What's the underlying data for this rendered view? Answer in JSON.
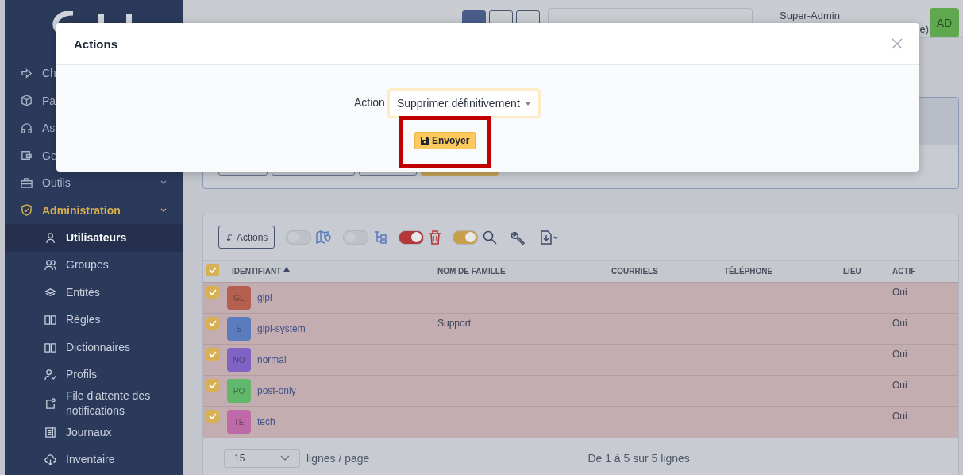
{
  "header": {
    "user": {
      "name": "Super-Admin",
      "entity": "e)",
      "initials": "AD"
    }
  },
  "sidebar": {
    "items": [
      {
        "label": "Ch",
        "selected": false
      },
      {
        "label": "Pa",
        "selected": false
      },
      {
        "label": "As",
        "selected": false
      },
      {
        "label": "Ge",
        "selected": false
      },
      {
        "label": "Outils",
        "selected": false,
        "submenu": true
      },
      {
        "label": "Administration",
        "selected": true,
        "submenu": true,
        "children": [
          {
            "label": "Utilisateurs",
            "selected": true
          },
          {
            "label": "Groupes",
            "selected": false
          },
          {
            "label": "Entités",
            "selected": false
          },
          {
            "label": "Règles",
            "selected": false
          },
          {
            "label": "Dictionnaires",
            "selected": false
          },
          {
            "label": "Profils",
            "selected": false
          },
          {
            "label": "File d'attente des notifications",
            "selected": false
          },
          {
            "label": "Journaux",
            "selected": false
          },
          {
            "label": "Inventaire",
            "selected": false
          }
        ]
      }
    ]
  },
  "modal": {
    "title": "Actions",
    "field_label": "Action",
    "select_value": "Supprimer définitivement",
    "submit": "Envoyer"
  },
  "toolbar": {
    "actions_button": "Actions",
    "toggles": [
      {
        "on": false
      },
      {
        "on": false
      },
      {
        "on": true,
        "color": "#b3383c"
      },
      {
        "on": true,
        "color": "#c9a04a"
      }
    ]
  },
  "table": {
    "all_checked": true,
    "columns": [
      {
        "label": "IDENTIFIANT",
        "sorted": true
      },
      {
        "label": "NOM DE FAMILLE",
        "sorted": false
      },
      {
        "label": "COURRIELS",
        "sorted": false
      },
      {
        "label": "TÉLÉPHONE",
        "sorted": false
      },
      {
        "label": "LIEU",
        "sorted": false
      },
      {
        "label": "ACTIF",
        "sorted": false
      }
    ],
    "rows": [
      {
        "checked": true,
        "initials": "GL",
        "color": "#b5604f",
        "login": "glpi",
        "active": "Oui"
      },
      {
        "checked": true,
        "initials": "S",
        "color": "#5a7bbd",
        "login": "glpi-system",
        "last_name": "Support",
        "active": "Oui"
      },
      {
        "checked": true,
        "initials": "NO",
        "color": "#8062c4",
        "login": "normal",
        "active": "Oui"
      },
      {
        "checked": true,
        "initials": "PO",
        "color": "#62b86a",
        "login": "post-only",
        "active": "Oui"
      },
      {
        "checked": true,
        "initials": "TE",
        "color": "#bf6aa8",
        "login": "tech",
        "active": "Oui"
      }
    ]
  },
  "pagination": {
    "per_page": "15",
    "per_page_label": "lignes / page",
    "summary": "De 1 à 5 sur 5 lignes"
  }
}
